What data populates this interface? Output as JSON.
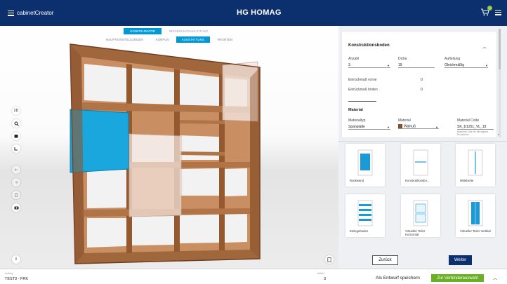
{
  "header": {
    "app_title": "cabinetCreator",
    "brand_mark": "HG",
    "brand": "HOMAG",
    "cart_count": "0"
  },
  "viewport": {
    "primary_tabs": [
      "KONFIGURATOR",
      "BEDIENUNGSANLEITUNG"
    ],
    "secondary_tabs": [
      "HAUPTEINSTELLUNGEN",
      "KORPUS",
      "AUSSTATTUNG",
      "FRONTEN"
    ],
    "tools": [
      "2D"
    ]
  },
  "properties": {
    "title": "Konstruktionsboden",
    "anzahl_label": "Anzahl",
    "anzahl_value": "3",
    "dicke_label": "Dicke",
    "dicke_value": "19",
    "aufteilung_label": "Aufteilung",
    "aufteilung_value": "Gleichmäßig",
    "einrueck_vorne_label": "Einrückmaß vorne",
    "einrueck_vorne_value": "0",
    "einrueck_hinten_label": "Einrückmaß hinten",
    "einrueck_hinten_value": "0",
    "material_heading": "Material",
    "materialtyp_label": "Materialtyp",
    "materialtyp_value": "Spanplatte",
    "material_label": "Material",
    "material_value": "Walnuß",
    "material_code_label": "Material Code",
    "material_code_value": "SK_D1251_VL_19",
    "material_code_note": "Material Code für die eigene Produktion"
  },
  "tiles": [
    {
      "label": "Rückwand"
    },
    {
      "label": "Konstruktionsbo..."
    },
    {
      "label": "Mittelseite"
    },
    {
      "label": "Einlegeboden"
    },
    {
      "label": "Virtueller Teiler Horizontal"
    },
    {
      "label": "Virtueller Teiler Vertikal"
    }
  ],
  "nav": {
    "back": "Zurück",
    "next": "Weiter"
  },
  "footer": {
    "auftrag_label": "Auftrag",
    "auftrag_value": "TEST3 - FRK",
    "artikel_label": "Artikel",
    "artikel_value": "3",
    "draft_button": "Als Entwurf speichern",
    "next_button": "Zur Verbinderauswahl"
  },
  "colors": {
    "header_bg": "#0c2f6e",
    "accent": "#0099d6",
    "walnut": "#8a4e2b",
    "green": "#6ab023"
  }
}
